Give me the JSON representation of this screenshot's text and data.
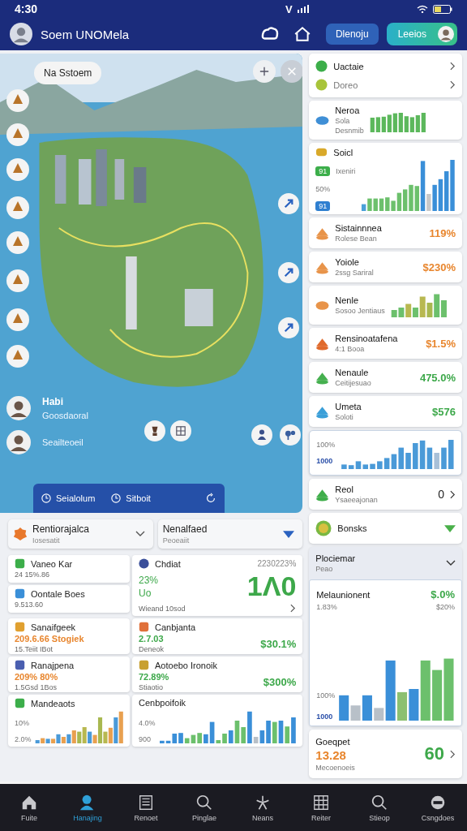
{
  "status_bar": {
    "time": "4:30",
    "carrier": "V"
  },
  "header": {
    "title": "Soem UNOMela",
    "buttons": [
      {
        "label": "Dlenoju",
        "kind": "plain"
      },
      {
        "label": "Leeios",
        "kind": "profile"
      }
    ]
  },
  "map": {
    "search": "Na Sstoem",
    "timeline": [
      {
        "title": "Habi",
        "subtitle": "Goosdaoral"
      },
      {
        "subtitle": "Seailteoeil"
      }
    ],
    "actions": [
      "Seialolum",
      "Sitboit"
    ]
  },
  "side": [
    {
      "kind": "links",
      "rows": [
        {
          "label": "Uactaie",
          "color": "#3cae4a"
        },
        {
          "label": "Doreo",
          "color": "#a8c43a"
        }
      ]
    },
    {
      "kind": "bars",
      "title": "Neroa",
      "lines": [
        "Sola",
        "Desnmib"
      ],
      "color": "#3f8fd6"
    },
    {
      "kind": "mixed",
      "title": "Soicl",
      "sub": "Ixeniri",
      "tick": "50%",
      "badges": [
        "91",
        "91"
      ],
      "color": "#d9a92a"
    },
    {
      "kind": "stat",
      "title": "Sistainnnea",
      "sub": "Rolese Bean",
      "value": "119%",
      "positive": false,
      "color": "#e8944a"
    },
    {
      "kind": "stat",
      "title": "Yoiole",
      "sub": "2ssg Sariral",
      "value": "$230%",
      "positive": false,
      "color": "#e8944a"
    },
    {
      "kind": "bars",
      "title": "Nenle",
      "lines": [
        "Sosoo Jentiaus"
      ],
      "color": "#e8944a"
    },
    {
      "kind": "stat",
      "title": "Rensinoatafena",
      "sub": "4:1 Booa",
      "value": "$1.5%",
      "positive": false,
      "color": "#e06a2c"
    },
    {
      "kind": "stat",
      "title": "Nenaule",
      "sub": "Ceitijesuao",
      "value": "475.0%",
      "positive": true,
      "color": "#45b04f"
    },
    {
      "kind": "stat",
      "title": "Umeta",
      "sub": "Soloti",
      "value": "$576",
      "positive": true,
      "color": "#3a9fd8"
    },
    {
      "kind": "chart",
      "ticks": [
        "100%",
        "1000"
      ]
    },
    {
      "kind": "count",
      "title": "Reol",
      "sub": "Ysaeeajonan",
      "value": "0",
      "color": "#3fae4a"
    },
    {
      "kind": "toggle",
      "title": "Bonsks",
      "color": "#7ab842"
    },
    {
      "kind": "panel",
      "title": "Plociemar",
      "sub": "Peao",
      "chart_title": "Melaunionent",
      "value": "$.0%",
      "value2": "$20%",
      "ticks": [
        "1.83%",
        "100%",
        "1000"
      ]
    },
    {
      "kind": "total",
      "title": "Goeqpet",
      "value": "13.28",
      "sub": "Mecoenoeis",
      "big": "60"
    }
  ],
  "dropdowns": [
    {
      "title": "Rentiorajalca",
      "subtitle": "Iosesatit",
      "kind": "chevron",
      "color": "#e8782c"
    },
    {
      "title": "Nenalfaed",
      "subtitle": "Peoeaiit",
      "kind": "triangle"
    }
  ],
  "summary": {
    "items": [
      {
        "title": "Vaneo Kar",
        "sub": "24 15%.86",
        "color": "#3cae4a"
      },
      {
        "title": "Oontale Boes",
        "sub": "9.513.60",
        "color": "#3a8fd8"
      }
    ],
    "feature": {
      "title": "Chdiat",
      "corner": "2230223%",
      "lines": [
        "23%",
        "Uo"
      ],
      "big": "1Λ0",
      "sub": "Wieand 10sod",
      "color": "#3a4f9a"
    }
  },
  "tiles": [
    {
      "kind": "stat",
      "title": "Sanaifgeek",
      "line": "209.6.66 Stogiek",
      "positive": false,
      "sub": "15.Teiit IBot",
      "color": "#e0a030"
    },
    {
      "kind": "stat",
      "title": "Canbjanta",
      "line": "2.7.03",
      "positive": true,
      "sub": "Deneok",
      "value": "$30.1%",
      "color": "#e0703a"
    },
    {
      "kind": "stat",
      "title": "Ranajpena",
      "line": "209% 80%",
      "positive": false,
      "sub": "1.5Gsd 1Bos",
      "color": "#4a5fb0"
    },
    {
      "kind": "stat",
      "title": "Aotoebo Ironoik",
      "line": "72.89%",
      "positive": true,
      "sub": "Stiaotio",
      "value": "$300%",
      "color": "#c8a030"
    },
    {
      "kind": "chart",
      "title": "Mandeaots",
      "ticks": [
        "10%",
        "2.0%"
      ],
      "color": "#3cae4a"
    },
    {
      "kind": "chart",
      "title": "Cenbpoifoik",
      "ticks": [
        "4.0%",
        "900"
      ]
    }
  ],
  "nav": [
    {
      "label": "Fuite",
      "selected": false
    },
    {
      "label": "Hanajing",
      "selected": true
    },
    {
      "label": "Renoet",
      "selected": false
    },
    {
      "label": "Pinglae",
      "selected": false
    },
    {
      "label": "Neans",
      "selected": false
    },
    {
      "label": "Reiter",
      "selected": false
    },
    {
      "label": "Stieop",
      "selected": false
    },
    {
      "label": "Csngdoes",
      "selected": false
    }
  ]
}
